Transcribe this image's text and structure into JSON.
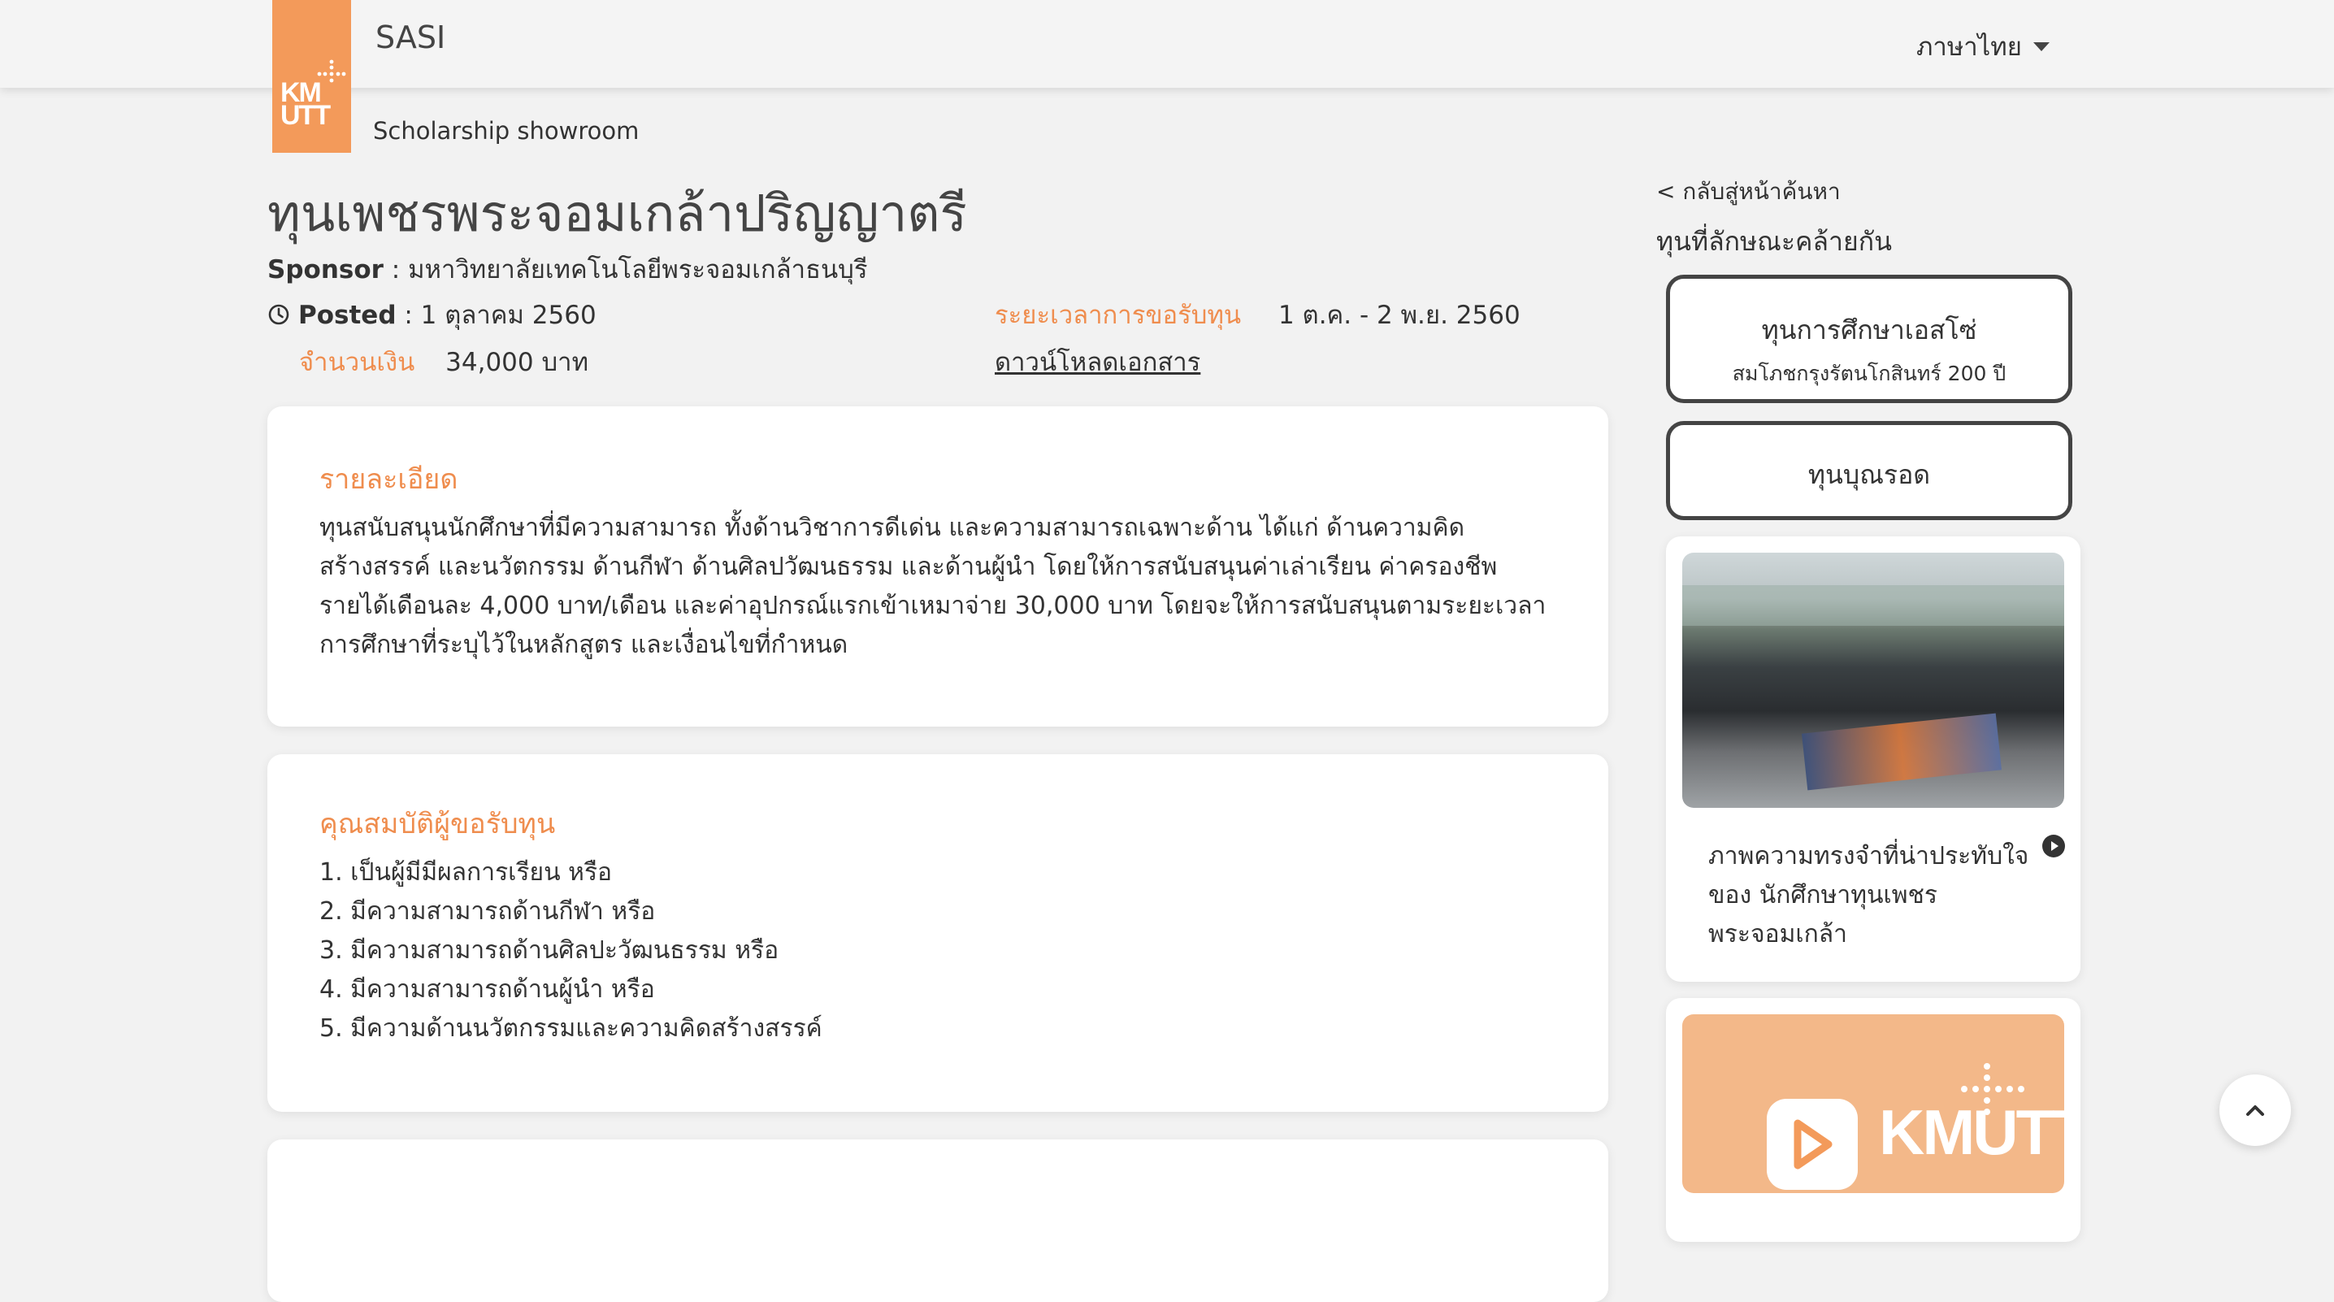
{
  "header": {
    "app_name": "SASI",
    "subtitle": "Scholarship showroom",
    "logo_text": "KMUTT",
    "language": "ภาษาไทย"
  },
  "scholarship": {
    "title": "ทุนเพชรพระจอมเกล้าปริญญาตรี",
    "sponsor_label": "Sponsor",
    "sponsor_value": " : มหาวิทยาลัยเทคโนโลยีพระจอมเกล้าธนบุรี",
    "posted_label": "Posted",
    "posted_value": " : 1 ตุลาคม 2560",
    "amount_label": "จำนวนเงิน",
    "amount_value": "34,000 บาท",
    "period_label": "ระยะเวลาการขอรับทุน",
    "period_value": "1 ต.ค. - 2 พ.ย. 2560",
    "download_label": "ดาวน์โหลดเอกสาร"
  },
  "details": {
    "heading": "รายละเอียด",
    "lines": [
      "ทุนสนับสนุนนักศึกษาที่มีความสามารถ ทั้งด้านวิชาการดีเด่น และความสามารถเฉพาะด้าน ได้แก่ ด้านความคิด",
      "สร้างสรรค์ และนวัตกรรม ด้านกีฬา ด้านศิลปวัฒนธรรม และด้านผู้นำ โดยให้การสนับสนุนค่าเล่าเรียน ค่าครองชีพ",
      "รายได้เดือนละ 4,000 บาท/เดือน และค่าอุปกรณ์แรกเข้าเหมาจ่าย 30,000 บาท โดยจะให้การสนับสนุนตามระยะเวลา",
      "การศึกษาที่ระบุไว้ในหลักสูตร และเงื่อนไขที่กำหนด"
    ]
  },
  "qualifications": {
    "heading": "คุณสมบัติผู้ขอรับทุน",
    "items": [
      "1. เป็นผู้มีมีผลการเรียน หรือ",
      "2. มีความสามารถด้านกีฬา หรือ",
      "3. มีความสามารถด้านศิลปะวัฒนธรรม หรือ",
      "4. มีความสามารถด้านผู้นำ หรือ",
      "5. มีความด้านนวัตกรรมและความคิดสร้างสรรค์"
    ]
  },
  "sidebar": {
    "back_link": "< กลับสู่หน้าค้นหา",
    "similar_heading": "ทุนที่ลักษณะคล้ายกัน",
    "similar": [
      {
        "title": "ทุนการศึกษาเอสโซ่",
        "subtitle": "สมโภชกรุงรัตนโกสินทร์ 200 ปี"
      },
      {
        "title": "ทุนบุณรอด"
      }
    ],
    "video_caption": "ภาพความทรงจำที่น่าประทับใจของ นักศึกษาทุนเพชรพระจอมเกล้า",
    "promo_logo_text": "KMUTT"
  },
  "colors": {
    "accent": "#ef8d4e",
    "logo_bg": "#f39a5a"
  }
}
